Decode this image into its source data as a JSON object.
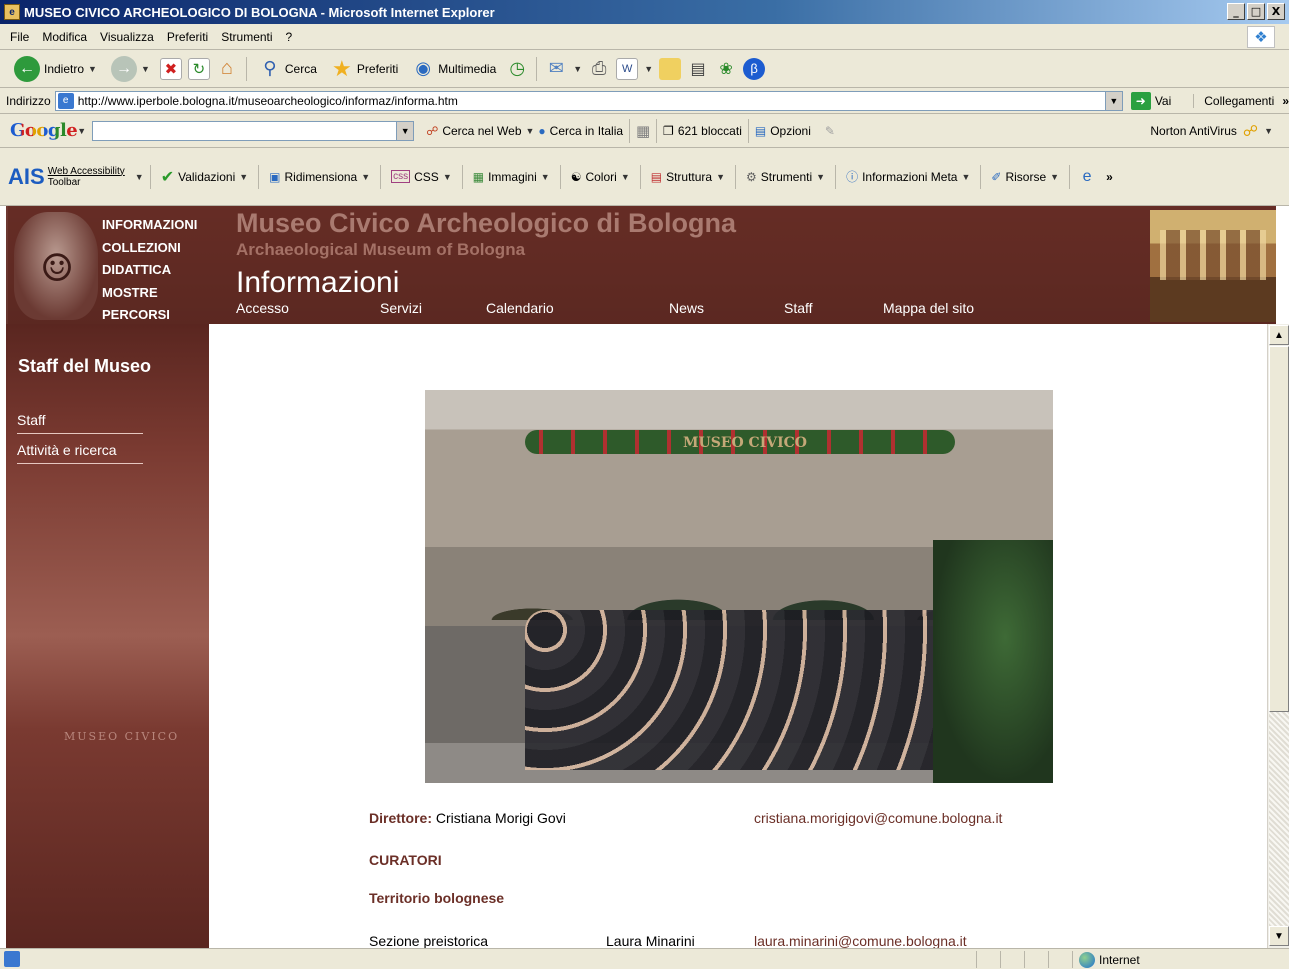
{
  "window": {
    "title": "MUSEO CIVICO ARCHEOLOGICO DI BOLOGNA - Microsoft Internet Explorer",
    "buttons": [
      "_",
      "□",
      "X"
    ]
  },
  "menu": [
    "File",
    "Modifica",
    "Visualizza",
    "Preferiti",
    "Strumenti",
    "?"
  ],
  "toolbar": {
    "back": "Indietro",
    "search": "Cerca",
    "favorites": "Preferiti",
    "media": "Multimedia"
  },
  "address": {
    "label": "Indirizzo",
    "url": "http://www.iperbole.bologna.it/museoarcheologico/informaz/informa.htm",
    "go": "Vai",
    "links": "Collegamenti"
  },
  "google": {
    "logo": "Google",
    "search_web": "Cerca nel Web",
    "search_italy": "Cerca in Italia",
    "blocked": "621 bloccati",
    "options": "Opzioni",
    "norton": "Norton AntiVirus"
  },
  "ais": {
    "logo": "AIS",
    "name_line1": "Web Accessibility",
    "name_line2": "Toolbar",
    "items": [
      "Validazioni",
      "Ridimensiona",
      "CSS",
      "Immagini",
      "Colori",
      "Struttura",
      "Strumenti",
      "Informazioni Meta",
      "Risorse"
    ]
  },
  "site": {
    "nav": [
      "INFORMAZIONI",
      "COLLEZIONI",
      "DIDATTICA",
      "MOSTRE",
      "PERCORSI"
    ],
    "title": "Museo Civico Archeologico di Bologna",
    "subtitle": "Archaeological Museum of Bologna",
    "section": "Informazioni",
    "subnav": [
      "Accesso",
      "Servizi",
      "Calendario",
      "News",
      "Staff",
      "Mappa del sito"
    ]
  },
  "sidebar": {
    "title": "Staff del Museo",
    "links": [
      "Staff",
      "Attività e ricerca"
    ],
    "watermark": "MUSEO CIVICO"
  },
  "photo": {
    "sign": "MUSEO CIVICO"
  },
  "content": {
    "director_label": "Direttore:",
    "director_name": "Cristiana Morigi Govi",
    "director_email": "cristiana.morigigovi@comune.bologna.it",
    "curators_heading": "CURATORI",
    "territory_heading": "Territorio bolognese",
    "rows": [
      {
        "section": "Sezione preistorica",
        "name": "Laura Minarini",
        "email": "laura.minarini@comune.bologna.it"
      }
    ]
  },
  "status": {
    "zone": "Internet"
  }
}
